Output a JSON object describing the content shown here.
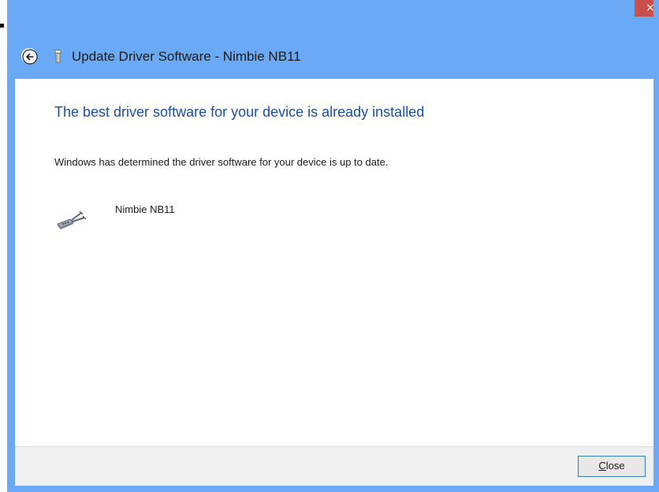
{
  "window": {
    "title": "Update Driver Software - Nimbie NB11",
    "close_glyph": "×",
    "title_icon": "usb-device-icon",
    "back_icon": "back-arrow-icon",
    "frame_color": "#6aa9f5",
    "close_color": "#c7504b"
  },
  "main": {
    "heading": "The best driver software for your device is already installed",
    "message": "Windows has determined the driver software for your device is up to date.",
    "device": {
      "name": "Nimbie NB11",
      "icon": "serial-port-device-icon"
    }
  },
  "footer": {
    "close_label_accel": "C",
    "close_label_rest": "lose"
  }
}
